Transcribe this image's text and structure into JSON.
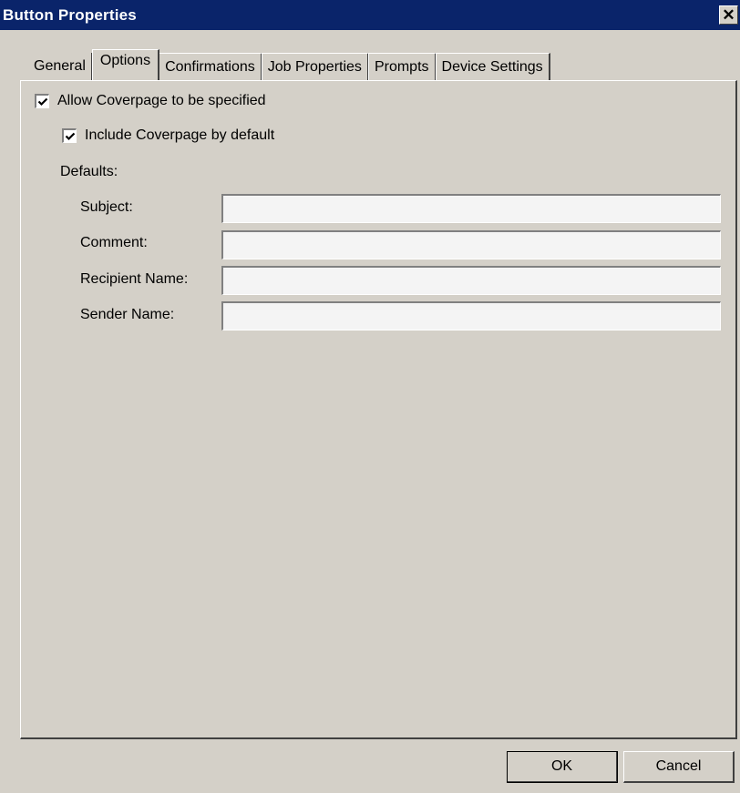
{
  "window": {
    "title": "Button Properties",
    "close_glyph": "✕"
  },
  "tabs": [
    {
      "label": "General",
      "active": false
    },
    {
      "label": "Options",
      "active": true
    },
    {
      "label": "Confirmations",
      "active": false
    },
    {
      "label": "Job Properties",
      "active": false
    },
    {
      "label": "Prompts",
      "active": false
    },
    {
      "label": "Device Settings",
      "active": false
    }
  ],
  "options": {
    "allow_coverpage": {
      "label": "Allow Coverpage to be specified",
      "checked": true
    },
    "include_coverpage": {
      "label": "Include Coverpage by default",
      "checked": true
    },
    "defaults_heading": "Defaults:",
    "fields": {
      "subject": {
        "label": "Subject:",
        "value": ""
      },
      "comment": {
        "label": "Comment:",
        "value": ""
      },
      "recipient_name": {
        "label": "Recipient Name:",
        "value": ""
      },
      "sender_name": {
        "label": "Sender Name:",
        "value": ""
      }
    }
  },
  "buttons": {
    "ok": "OK",
    "cancel": "Cancel"
  },
  "colors": {
    "titlebar": "#0a246a",
    "face": "#d4d0c8",
    "field_bg": "#f4f4f4"
  },
  "icons": {
    "check": "checkmark-icon",
    "close": "close-icon"
  }
}
